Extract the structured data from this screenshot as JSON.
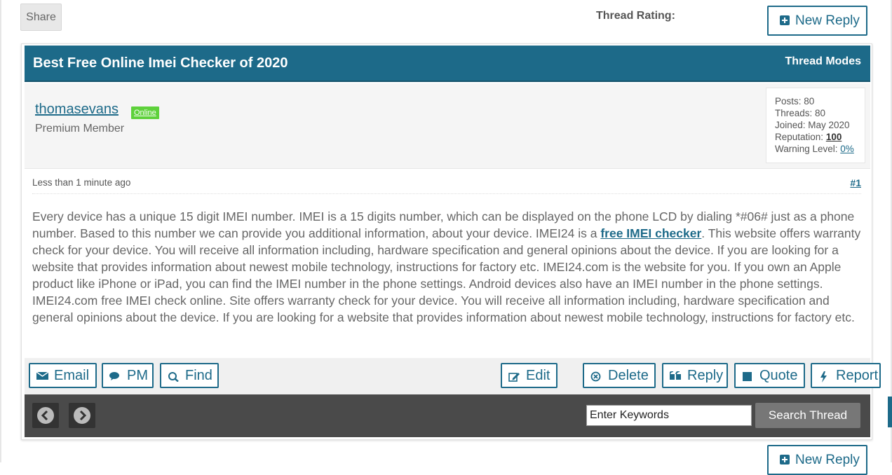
{
  "top_bar": {
    "share_label": "Share",
    "rating_label": "Thread Rating:",
    "new_reply_label": "New Reply"
  },
  "thread": {
    "title": "Best Free Online Imei Checker of 2020",
    "modes_label": "Thread Modes"
  },
  "author": {
    "username": "thomasevans",
    "status": "Online",
    "usertitle": "Premium Member",
    "stats": {
      "posts": "Posts: 80",
      "threads": "Threads: 80",
      "joined": "Joined: May 2020",
      "reputation_label": "Reputation: ",
      "reputation_value": "100",
      "warning_label": "Warning Level: ",
      "warning_value": "0%"
    }
  },
  "post": {
    "time": "Less than 1 minute ago",
    "number": "#1",
    "body_before_link": "Every device has a unique 15 digit IMEI number. IMEI is a 15 digits number, which can be displayed on the phone LCD by dialing *#06# just as a phone number. Based to this number we can provide you additional information, about your device. IMEI24 is a ",
    "link_text": "free IMEI checker",
    "body_after_link": ". This website offers warranty check for your device. You will receive all information including, hardware specification and general opinions about the device. If you are looking for a website that provides information about newest mobile technology, instructions for factory etc. IMEI24.com is the website for you.  If you own an Apple product like iPhone or iPad, you can find the IMEI number in the phone settings. Android devices also have an IMEI number in the phone settings. IMEI24.com free IMEI check online. Site offers warranty check for your device. You will receive all information including, hardware specification and general opinions about the device. If you are looking for a website that provides information about newest mobile technology, instructions for factory etc."
  },
  "post_buttons": {
    "email": "Email",
    "pm": "PM",
    "find": "Find",
    "edit": "Edit",
    "delete": "Delete",
    "reply": "Reply",
    "quote": "Quote",
    "report": "Report"
  },
  "search": {
    "value": "Enter Keywords",
    "button_label": "Search Thread"
  },
  "icons": {
    "prev": "chevron-left-icon",
    "next": "chevron-right-icon",
    "plus": "plus-square-icon"
  },
  "colors": {
    "accent": "#1d6a89",
    "online": "#5ed13b",
    "bar": "#4a4a4a"
  }
}
